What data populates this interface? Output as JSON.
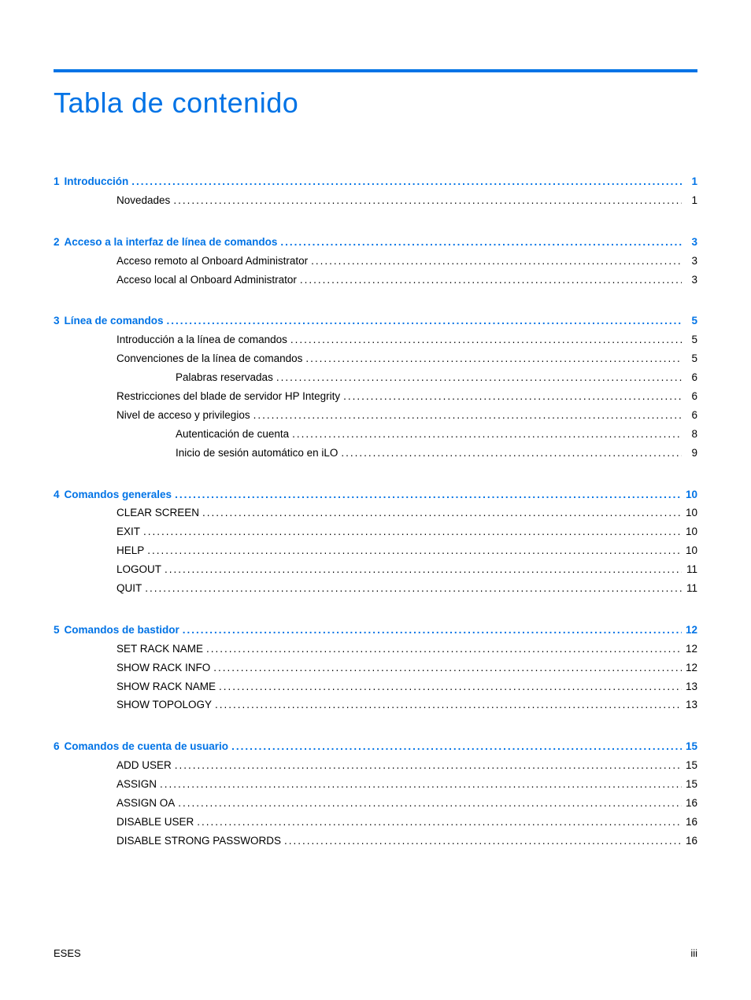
{
  "title": "Tabla de contenido",
  "footer_left": "ESES",
  "footer_right": "iii",
  "sections": [
    {
      "num": "1",
      "label": "Introducción",
      "page": "1",
      "items": [
        {
          "level": 1,
          "label": "Novedades",
          "page": "1"
        }
      ]
    },
    {
      "num": "2",
      "label": "Acceso a la interfaz de línea de comandos",
      "page": "3",
      "items": [
        {
          "level": 1,
          "label": "Acceso remoto al Onboard Administrator",
          "page": "3"
        },
        {
          "level": 1,
          "label": "Acceso local al Onboard Administrator",
          "page": "3"
        }
      ]
    },
    {
      "num": "3",
      "label": "Línea de comandos",
      "page": "5",
      "items": [
        {
          "level": 1,
          "label": "Introducción a la línea de comandos",
          "page": "5"
        },
        {
          "level": 1,
          "label": "Convenciones de la línea de comandos",
          "page": "5"
        },
        {
          "level": 2,
          "label": "Palabras reservadas",
          "page": "6"
        },
        {
          "level": 1,
          "label": "Restricciones del blade de servidor HP Integrity",
          "page": "6"
        },
        {
          "level": 1,
          "label": "Nivel de acceso y privilegios",
          "page": "6"
        },
        {
          "level": 2,
          "label": "Autenticación de cuenta",
          "page": "8"
        },
        {
          "level": 2,
          "label": "Inicio de sesión automático en iLO",
          "page": "9"
        }
      ]
    },
    {
      "num": "4",
      "label": "Comandos generales",
      "page": "10",
      "items": [
        {
          "level": 1,
          "label": "CLEAR SCREEN",
          "page": "10"
        },
        {
          "level": 1,
          "label": "EXIT",
          "page": "10"
        },
        {
          "level": 1,
          "label": "HELP",
          "page": "10"
        },
        {
          "level": 1,
          "label": "LOGOUT",
          "page": "11"
        },
        {
          "level": 1,
          "label": "QUIT",
          "page": "11"
        }
      ]
    },
    {
      "num": "5",
      "label": "Comandos de bastidor",
      "page": "12",
      "items": [
        {
          "level": 1,
          "label": "SET RACK NAME",
          "page": "12"
        },
        {
          "level": 1,
          "label": "SHOW RACK INFO",
          "page": "12"
        },
        {
          "level": 1,
          "label": "SHOW RACK NAME",
          "page": "13"
        },
        {
          "level": 1,
          "label": "SHOW TOPOLOGY",
          "page": "13"
        }
      ]
    },
    {
      "num": "6",
      "label": "Comandos de cuenta de usuario",
      "page": "15",
      "items": [
        {
          "level": 1,
          "label": "ADD USER",
          "page": "15"
        },
        {
          "level": 1,
          "label": "ASSIGN",
          "page": "15"
        },
        {
          "level": 1,
          "label": "ASSIGN OA",
          "page": "16"
        },
        {
          "level": 1,
          "label": "DISABLE USER",
          "page": "16"
        },
        {
          "level": 1,
          "label": "DISABLE STRONG PASSWORDS",
          "page": "16"
        }
      ]
    }
  ]
}
